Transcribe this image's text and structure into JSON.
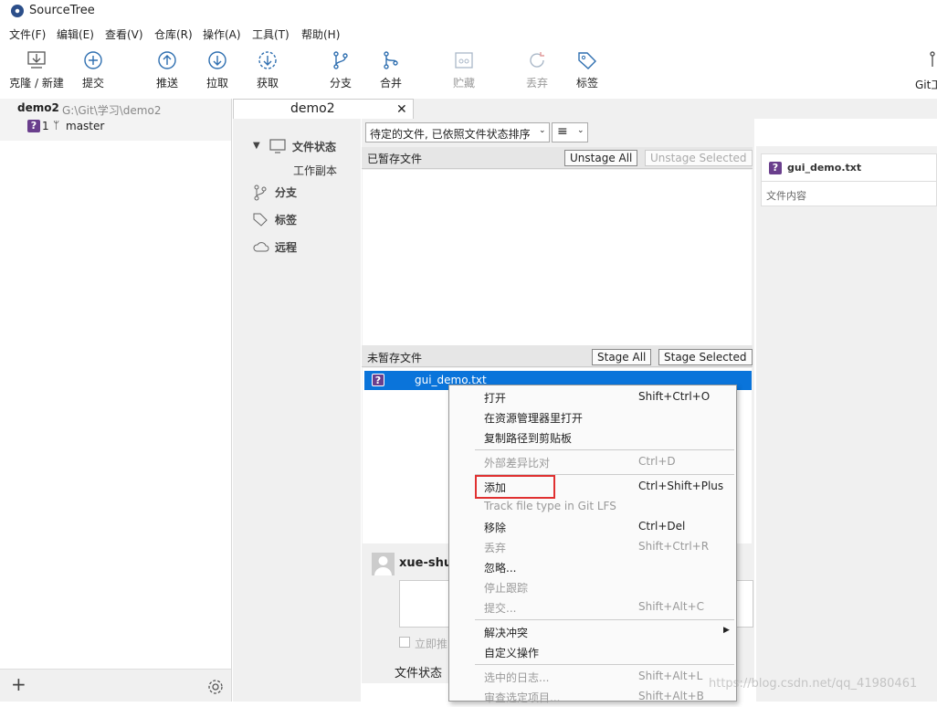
{
  "window": {
    "title": "SourceTree"
  },
  "menu": [
    "文件(F)",
    "编辑(E)",
    "查看(V)",
    "仓库(R)",
    "操作(A)",
    "工具(T)",
    "帮助(H)"
  ],
  "toolbar": [
    {
      "label": "克隆 / 新建",
      "icon": "clone-icon",
      "enabled": true
    },
    {
      "label": "提交",
      "icon": "commit-icon",
      "enabled": true
    },
    {
      "label": "推送",
      "icon": "push-icon",
      "enabled": true
    },
    {
      "label": "拉取",
      "icon": "pull-icon",
      "enabled": true
    },
    {
      "label": "获取",
      "icon": "fetch-icon",
      "enabled": true
    },
    {
      "label": "分支",
      "icon": "branch-icon",
      "enabled": true
    },
    {
      "label": "合并",
      "icon": "merge-icon",
      "enabled": true
    },
    {
      "label": "贮藏",
      "icon": "stash-icon",
      "enabled": false
    },
    {
      "label": "丢弃",
      "icon": "discard-icon",
      "enabled": false
    },
    {
      "label": "标签",
      "icon": "tag-icon",
      "enabled": true
    },
    {
      "label": "Git工",
      "icon": "git-flow-icon",
      "enabled": true
    }
  ],
  "repo": {
    "name": "demo2",
    "path": "G:\\Git\\学习\\demo2",
    "count": "1",
    "branch": "master"
  },
  "tab": {
    "title": "demo2",
    "close": "✕"
  },
  "nav": {
    "file_status": "文件状态",
    "working_copy": "工作副本",
    "branches": "分支",
    "tags": "标签",
    "remotes": "远程"
  },
  "filter": {
    "sort_label": "待定的文件, 已依照文件状态排序",
    "view_icon": "≡"
  },
  "staged": {
    "title": "已暂存文件",
    "unstage_all": "Unstage All",
    "unstage_selected": "Unstage Selected"
  },
  "unstaged": {
    "title": "未暂存文件",
    "stage_all": "Stage All",
    "stage_selected": "Stage Selected",
    "files": [
      {
        "name": "gui_demo.txt",
        "status": "?"
      }
    ]
  },
  "preview": {
    "filename": "gui_demo.txt",
    "content_label": "文件内容"
  },
  "commit": {
    "author": "xue-shu",
    "push_label": "立即推",
    "footer_tab": "文件状态"
  },
  "context_menu": [
    {
      "label": "打开",
      "shortcut": "Shift+Ctrl+O",
      "enabled": true
    },
    {
      "label": "在资源管理器里打开",
      "shortcut": "",
      "enabled": true
    },
    {
      "label": "复制路径到剪贴板",
      "shortcut": "",
      "enabled": true
    },
    {
      "label": "外部差异比对",
      "shortcut": "Ctrl+D",
      "enabled": false
    },
    {
      "label": "添加",
      "shortcut": "Ctrl+Shift+Plus",
      "enabled": true,
      "highlighted": true
    },
    {
      "label": "Track file type in Git LFS",
      "shortcut": "",
      "enabled": false
    },
    {
      "label": "移除",
      "shortcut": "Ctrl+Del",
      "enabled": true
    },
    {
      "label": "丢弃",
      "shortcut": "Shift+Ctrl+R",
      "enabled": false
    },
    {
      "label": "忽略...",
      "shortcut": "",
      "enabled": true
    },
    {
      "label": "停止跟踪",
      "shortcut": "",
      "enabled": false
    },
    {
      "label": "提交...",
      "shortcut": "Shift+Alt+C",
      "enabled": false
    },
    {
      "label": "解决冲突",
      "shortcut": "",
      "enabled": true,
      "submenu": true
    },
    {
      "label": "自定义操作",
      "shortcut": "",
      "enabled": true
    },
    {
      "label": "选中的日志...",
      "shortcut": "Shift+Alt+L",
      "enabled": false
    },
    {
      "label": "审查选定项目...",
      "shortcut": "Shift+Alt+B",
      "enabled": false
    }
  ],
  "watermark": "https://blog.csdn.net/qq_41980461",
  "colors": {
    "selection": "#0a74da",
    "highlight_box": "#e03030",
    "file_status_icon": "#6a3f8d"
  }
}
